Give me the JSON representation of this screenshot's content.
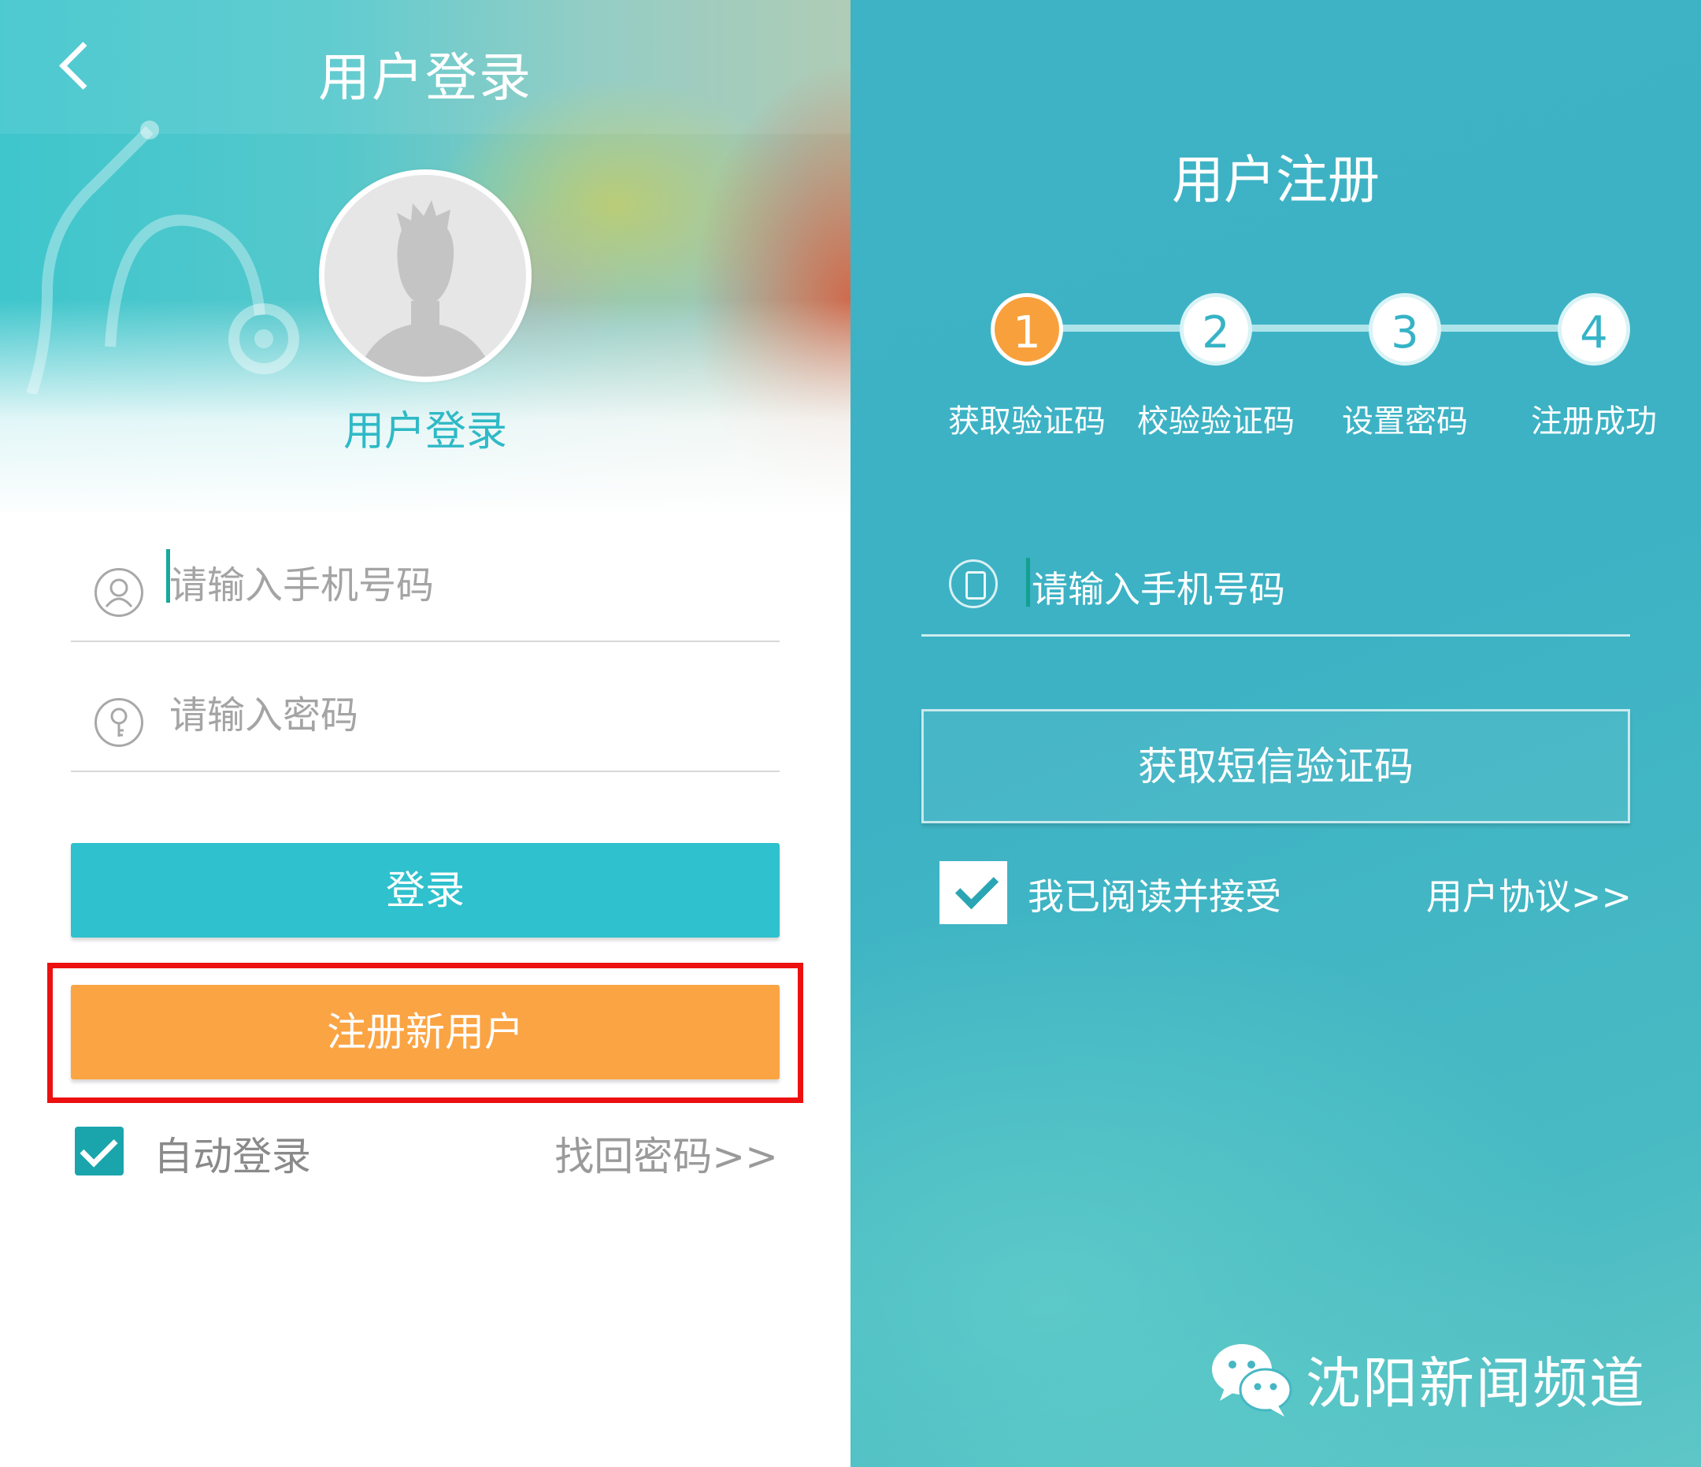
{
  "login": {
    "title": "用户登录",
    "avatar_caption": "用户登录",
    "phone_placeholder": "请输入手机号码",
    "password_placeholder": "请输入密码",
    "login_button": "登录",
    "register_button": "注册新用户",
    "auto_login_label": "自动登录",
    "auto_login_checked": true,
    "forgot_password_link": "找回密码>>"
  },
  "register": {
    "title": "用户注册",
    "steps": [
      {
        "number": "1",
        "label": "获取验证码",
        "active": true
      },
      {
        "number": "2",
        "label": "校验验证码",
        "active": false
      },
      {
        "number": "3",
        "label": "设置密码",
        "active": false
      },
      {
        "number": "4",
        "label": "注册成功",
        "active": false
      }
    ],
    "phone_placeholder": "请输入手机号码",
    "sms_button": "获取短信验证码",
    "agree_text": "我已阅读并接受",
    "agree_checked": true,
    "agreement_link": "用户协议>>"
  },
  "watermark": {
    "icon": "wechat-icon",
    "text": "沈阳新闻频道"
  },
  "colors": {
    "teal_accent": "#2fc1cd",
    "orange_accent": "#fba444",
    "highlight_red": "#ec1010",
    "register_bg": "#3fb3c6"
  }
}
